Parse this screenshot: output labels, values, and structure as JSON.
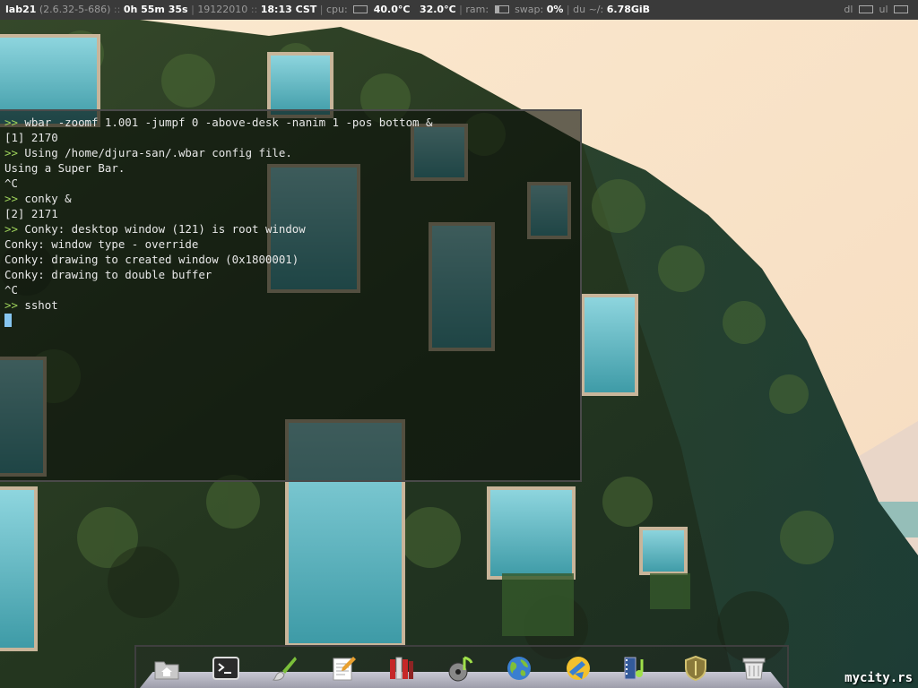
{
  "topbar": {
    "host": "lab21",
    "kernel": "(2.6.32-5-686)",
    "sep1": "::",
    "uptime": "0h 55m 35s",
    "sep2": "|",
    "date": "19122010",
    "sep3": "::",
    "time": "18:13 CST",
    "sep4": "|",
    "cpu_label": "cpu:",
    "cpu_temp": "40.0°C",
    "temp2": "32.0°C",
    "sep5": "|",
    "ram_label": "ram:",
    "ram_fraction": 0.3,
    "cpu_fraction": 0.0,
    "swap_label": "swap:",
    "swap_value": "0%",
    "sep6": "|",
    "du_label": "du ~/:",
    "du_value": "6.78GiB",
    "dl_label": "dl",
    "ul_label": "ul"
  },
  "terminal": {
    "prompt": ">>",
    "lines": [
      {
        "prompt": true,
        "text": "wbar -zoomf 1.001 -jumpf 0 -above-desk -nanim 1 -pos bottom &"
      },
      {
        "prompt": false,
        "text": "[1] 2170"
      },
      {
        "prompt": true,
        "text": "Using /home/djura-san/.wbar config file."
      },
      {
        "prompt": false,
        "text": "Using a Super Bar."
      },
      {
        "prompt": false,
        "text": "^C"
      },
      {
        "prompt": true,
        "text": "conky &"
      },
      {
        "prompt": false,
        "text": "[2] 2171"
      },
      {
        "prompt": true,
        "text": "Conky: desktop window (121) is root window"
      },
      {
        "prompt": false,
        "text": "Conky: window type - override"
      },
      {
        "prompt": false,
        "text": "Conky: drawing to created window (0x1800001)"
      },
      {
        "prompt": false,
        "text": "Conky: drawing to double buffer"
      },
      {
        "prompt": false,
        "text": "^C"
      },
      {
        "prompt": true,
        "text": "sshot"
      }
    ]
  },
  "dock": {
    "icons": [
      "home-folder-icon",
      "terminal-icon",
      "paint-brush-icon",
      "text-editor-icon",
      "books-icon",
      "music-player-icon",
      "web-browser-globe-icon",
      "ftp-client-icon",
      "video-player-icon",
      "security-shield-icon",
      "trash-icon"
    ]
  },
  "watermark": "mycity.rs",
  "colors": {
    "topbar_bg": "#3a3a3a",
    "prompt": "#9fd35b",
    "cursor": "#86c5f0",
    "terminal_text": "#e8e8e8"
  }
}
